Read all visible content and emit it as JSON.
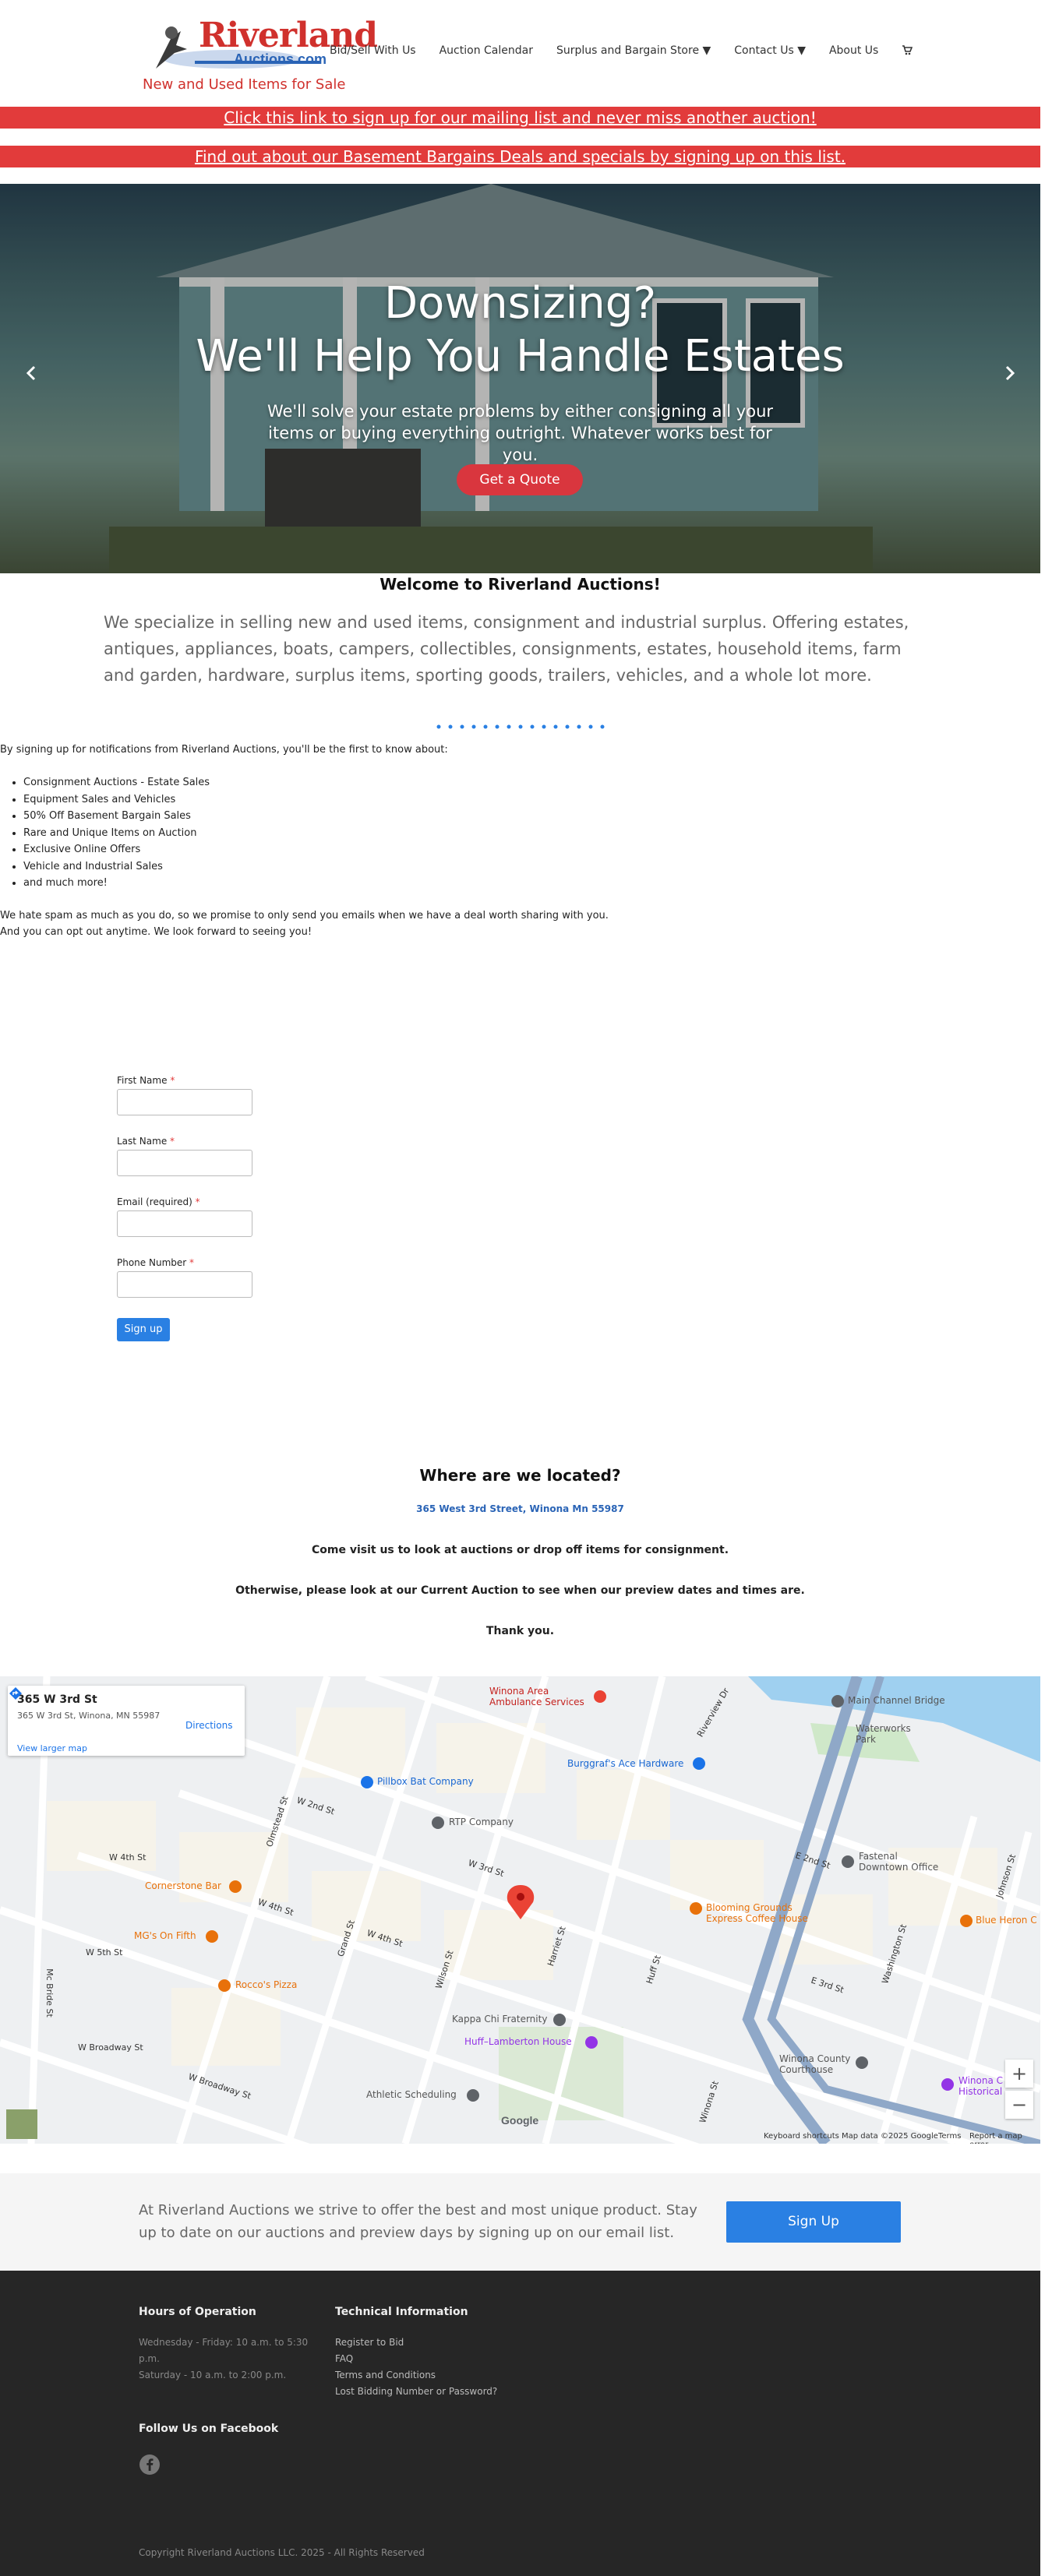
{
  "header": {
    "logo_text": "Riverland",
    "logo_sub": "Auctions.com",
    "tagline": "New and Used Items for Sale",
    "nav": [
      {
        "label": "Bid/Sell With Us"
      },
      {
        "label": "Auction Calendar"
      },
      {
        "label": "Surplus and Bargain Store ▼"
      },
      {
        "label": "Contact Us ▼"
      },
      {
        "label": "About Us"
      }
    ],
    "cart_icon": "cart-icon"
  },
  "banners": {
    "mailing": "Click this link to sign up for our mailing list and never miss another auction!",
    "basement": "Find out about our Basement Bargains Deals and specials by signing up on this list."
  },
  "hero": {
    "line1": "Downsizing?",
    "line2": "We'll Help You Handle Estates",
    "paragraph": "We'll solve your estate problems by either consigning all your items or buying everything outright. Whatever works best for you.",
    "button": "Get a Quote",
    "prev_icon": "chevron-left-icon",
    "next_icon": "chevron-right-icon"
  },
  "welcome": {
    "title": "Welcome to Riverland Auctions!",
    "text": "We specialize in selling new and used items, consignment and industrial surplus. Offering estates, antiques, appliances, boats, campers, collectibles, consignments, estates, household items, farm and garden, hardware, surplus items, sporting goods, trailers, vehicles, and a whole lot more."
  },
  "signup": {
    "intro": "By signing up for notifications from Riverland Auctions, you'll be the first to know about:",
    "list": [
      "Consignment Auctions - Estate Sales",
      "Equipment Sales and Vehicles",
      "50% Off Basement Bargain Sales",
      "Rare and Unique Items on Auction",
      "Exclusive Online Offers",
      "Vehicle and Industrial Sales",
      "and much more!"
    ],
    "spam_1": "We hate spam as much as you do, so we promise to only send you emails when we have a deal worth sharing with you.",
    "spam_2": "And you can opt out anytime. We look forward to seeing you!"
  },
  "form": {
    "first_name": "First Name",
    "last_name": "Last Name",
    "email": "Email (required)",
    "phone": "Phone Number",
    "required_mark": "*",
    "submit": "Sign up"
  },
  "location": {
    "title": "Where are we located?",
    "address": "365 West 3rd Street, Winona Mn 55987",
    "line1": "Come visit us to look at auctions or drop off items for consignment.",
    "line2": "Otherwise, please look at our Current Auction to see when our preview dates and times are.",
    "line3": "Thank you."
  },
  "map": {
    "card_title": "365 W 3rd St",
    "card_address": "365 W 3rd St, Winona, MN 55987",
    "directions": "Directions",
    "larger_map": "View larger map",
    "pois": {
      "ambulance_1": "Winona Area",
      "ambulance_2": "Ambulance Services",
      "channel": "Main Channel Bridge",
      "waterworks_1": "Waterworks",
      "waterworks_2": "Park",
      "burggraf": "Burggraf's Ace Hardware",
      "pillbox": "Pillbox Bat Company",
      "rtp": "RTP Company",
      "fastenal_1": "Fastenal",
      "fastenal_2": "Downtown Office",
      "cornerstone": "Cornerstone Bar",
      "mgs": "MG's On Fifth",
      "blooming_1": "Blooming Grounds",
      "blooming_2": "Express Coffee House",
      "blueheron": "Blue Heron C",
      "roccos": "Rocco's Pizza",
      "kappa": "Kappa Chi Fraternity",
      "huff": "Huff–Lamberton House",
      "courthouse_1": "Winona County",
      "courthouse_2": "Courthouse",
      "historical_1": "Winona C",
      "historical_2": "Historical",
      "athletic": "Athletic Scheduling"
    },
    "streets": {
      "w2nd": "W 2nd St",
      "w3rd": "W 3rd St",
      "w4th": "W 4th St",
      "w5th": "W 5th St",
      "wbroadway": "W Broadway St",
      "olmstead": "Olmstead St",
      "grand": "Grand St",
      "wilson": "Wilson St",
      "harriet": "Harriet St",
      "huff": "Huff St",
      "washington": "Washington St",
      "johnson": "Johnson St",
      "winona": "Winona St",
      "mcbride": "Mc Bride St",
      "riverview": "Riverview Dr",
      "e2nd": "E 2nd St",
      "e3rd": "E 3rd St"
    },
    "footer": {
      "shortcuts": "Keyboard shortcuts",
      "mapdata": "Map data ©2025 Google",
      "terms": "Terms",
      "report": "Report a map error"
    },
    "zoom_in": "+",
    "zoom_out": "−",
    "google": "Google"
  },
  "cta": {
    "text": "At Riverland Auctions we strive to offer the best and most unique product. Stay up to date on our auctions and preview days by signing up on our email list.",
    "button": "Sign Up"
  },
  "footer": {
    "hours_title": "Hours of Operation",
    "hours_1": "Wednesday - Friday: 10 a.m. to 5:30",
    "hours_2": "p.m.",
    "hours_3": "Saturday - 10 a.m. to 2:00 p.m.",
    "tech_title": "Technical Information",
    "tech_links": [
      "Register to Bid",
      "FAQ",
      "Terms and Conditions",
      "Lost Bidding Number or Password?"
    ],
    "facebook_title": "Follow Us on Facebook",
    "copyright": "Copyright Riverland Auctions LLC. 2025 - All Rights Reserved"
  }
}
